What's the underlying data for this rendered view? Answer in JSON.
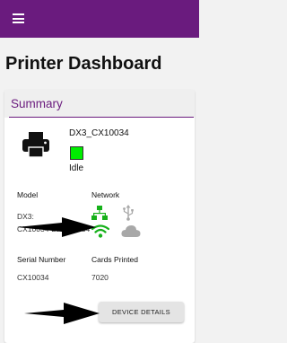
{
  "app": {
    "page_title": "Printer Dashboard"
  },
  "summary": {
    "title": "Summary",
    "device_name": "DX3_CX10034",
    "status": "Idle",
    "status_color": "#00ee00",
    "model_label": "Model",
    "model_value_line1": "DX3:",
    "model_value_line2": "CX10034-DX3-10034",
    "network_label": "Network",
    "serial_label": "Serial Number",
    "serial_value": "CX10034",
    "cards_label": "Cards Printed",
    "cards_value": "7020",
    "details_button": "DEVICE DETAILS"
  },
  "icons": {
    "menu": "hamburger-menu-icon",
    "printer": "printer-icon",
    "ethernet": "ethernet-network-icon",
    "wifi": "wifi-icon",
    "usb": "usb-icon",
    "cloud": "cloud-icon"
  },
  "colors": {
    "brand": "#6a1b7e",
    "network_active": "#16b11a",
    "network_inactive": "#a8a8a8"
  }
}
